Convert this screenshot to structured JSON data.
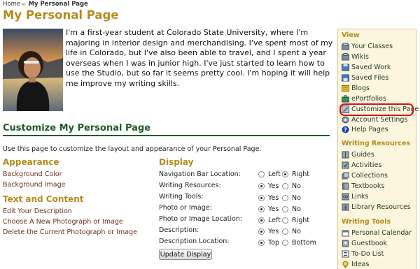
{
  "breadcrumb": {
    "home": "Home",
    "current": "My Personal Page"
  },
  "page_title": "My Personal Page",
  "bio": "I'm a first-year student at Colorado State University, where I'm majoring in interior design and merchandising. I've spent most of my life in Colorado, but I've also been able to travel, and I spent a year overseas when I was in junior high. I've just started to learn how to use the Studio, but so far it seems pretty cool. I'm hoping it will help me improve my writing skills.",
  "customize": {
    "title": "Customize My Personal Page",
    "intro": "Use this page to customize the layout and appearance of your Personal Page."
  },
  "appearance": {
    "heading": "Appearance",
    "links": [
      "Background Color",
      "Background Image"
    ]
  },
  "text_content": {
    "heading": "Text and Content",
    "links": [
      "Edit Your Description",
      "Choose A New Photograph or Image",
      "Delete the Current Photograph or Image"
    ]
  },
  "display": {
    "heading": "Display",
    "settings": [
      {
        "label": "Navigation Bar Location:",
        "options": [
          "Left",
          "Right"
        ],
        "selected": "Right"
      },
      {
        "label": "Writing Resources:",
        "options": [
          "Yes",
          "No"
        ],
        "selected": "Yes"
      },
      {
        "label": "Writing Tools:",
        "options": [
          "Yes",
          "No"
        ],
        "selected": "Yes"
      },
      {
        "label": "Photo or Image:",
        "options": [
          "Yes",
          "No"
        ],
        "selected": "Yes"
      },
      {
        "label": "Photo or Image Location:",
        "options": [
          "Left",
          "Right"
        ],
        "selected": "Left"
      },
      {
        "label": "Description:",
        "options": [
          "Yes",
          "No"
        ],
        "selected": "Yes"
      },
      {
        "label": "Description Location:",
        "options": [
          "Top",
          "Bottom"
        ],
        "selected": "Top"
      }
    ],
    "button": "Update Display"
  },
  "sidebar": {
    "view": {
      "heading": "View",
      "items": [
        {
          "label": "Your Classes",
          "icon": "classes-icon"
        },
        {
          "label": "Wikis",
          "icon": "wikis-icon"
        },
        {
          "label": "Saved Work",
          "icon": "saved-work-icon"
        },
        {
          "label": "Saved Files",
          "icon": "saved-files-icon"
        },
        {
          "label": "Blogs",
          "icon": "blogs-icon"
        },
        {
          "label": "ePortfolios",
          "icon": "eportfolios-icon"
        },
        {
          "label": "Customize this Page",
          "icon": "customize-icon"
        },
        {
          "label": "Account Settings",
          "icon": "account-settings-icon"
        },
        {
          "label": "Help Pages",
          "icon": "help-icon"
        }
      ]
    },
    "resources": {
      "heading": "Writing Resources",
      "items": [
        {
          "label": "Guides",
          "icon": "guides-icon"
        },
        {
          "label": "Activities",
          "icon": "activities-icon"
        },
        {
          "label": "Collections",
          "icon": "collections-icon"
        },
        {
          "label": "Textbooks",
          "icon": "textbooks-icon"
        },
        {
          "label": "Links",
          "icon": "links-icon"
        },
        {
          "label": "Library Resources",
          "icon": "library-icon"
        }
      ]
    },
    "tools": {
      "heading": "Writing Tools",
      "items": [
        {
          "label": "Personal Calendar",
          "icon": "calendar-icon"
        },
        {
          "label": "Guestbook",
          "icon": "guestbook-icon"
        },
        {
          "label": "To-Do List",
          "icon": "todo-icon"
        },
        {
          "label": "Ideas",
          "icon": "ideas-icon"
        }
      ]
    }
  },
  "colors": {
    "title_gold": "#b58b1e",
    "heading_green": "#1f5c2b",
    "link_brown": "#6b3020",
    "highlight_red": "#d6141a",
    "sidebar_bg": "#fbf6dd"
  }
}
